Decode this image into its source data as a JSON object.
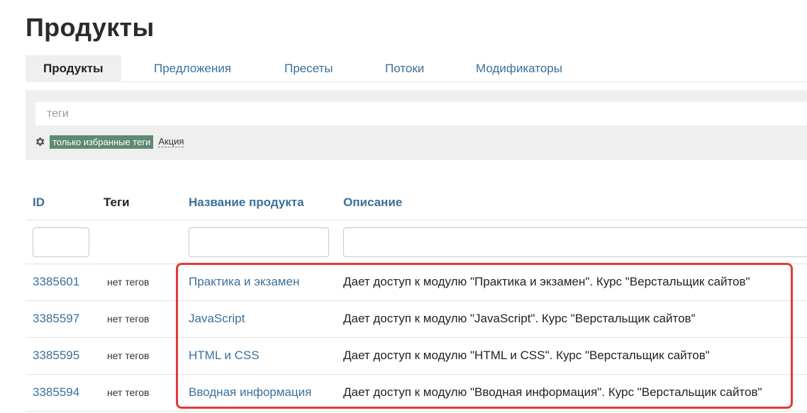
{
  "page": {
    "title": "Продукты"
  },
  "tabs": [
    {
      "label": "Продукты",
      "active": true
    },
    {
      "label": "Предложения",
      "active": false
    },
    {
      "label": "Пресеты",
      "active": false
    },
    {
      "label": "Потоки",
      "active": false
    },
    {
      "label": "Модификаторы",
      "active": false
    }
  ],
  "filter": {
    "tags_placeholder": "теги",
    "settings_icon": "gear-icon",
    "favorite_tags_label": "только избранные теги",
    "tags": [
      "Акция"
    ]
  },
  "table": {
    "columns": [
      "ID",
      "Теги",
      "Название продукта",
      "Описание"
    ],
    "rows": [
      {
        "id": "3385601",
        "tags": "нет тегов",
        "name": "Практика и экзамен",
        "description": "Дает доступ к модулю \"Практика и экзамен\". Курс \"Верстальщик сайтов\""
      },
      {
        "id": "3385597",
        "tags": "нет тегов",
        "name": "JavaScript",
        "description": "Дает доступ к модулю \"JavaScript\". Курс \"Верстальщик сайтов\""
      },
      {
        "id": "3385595",
        "tags": "нет тегов",
        "name": "HTML и CSS",
        "description": "Дает доступ к модулю \"HTML и CSS\". Курс \"Верстальщик сайтов\""
      },
      {
        "id": "3385594",
        "tags": "нет тегов",
        "name": "Вводная информация",
        "description": "Дает доступ к модулю \"Вводная информация\". Курс \"Верстальщик сайтов\""
      }
    ]
  },
  "colors": {
    "link": "#3c6f99",
    "tag_chip": "#5c8a73",
    "highlight": "#e03a3a",
    "panel_bg": "#efefef"
  }
}
